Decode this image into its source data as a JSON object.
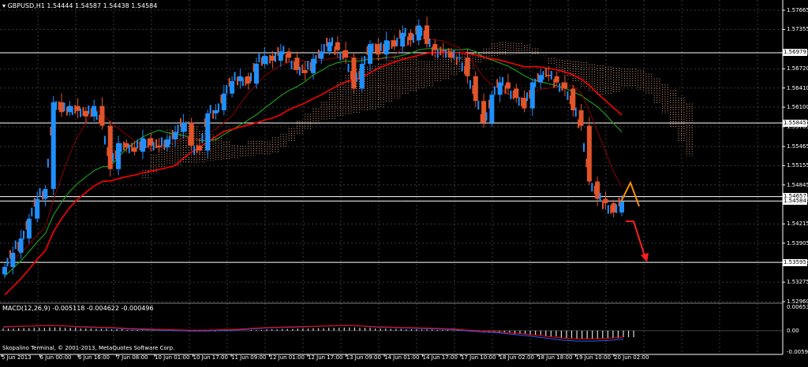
{
  "chart_header": {
    "symbol_title": "GBPUSD,H1",
    "ohlc": "1.54444 1.54587 1.54438 1.54584"
  },
  "macd_header": {
    "title": "MACD(12,26,9)",
    "values": "-0.005118 -0.004622 -0.000496"
  },
  "copyright": "Skopalino Terminal, © 2001-2013, MetaQuotes Software Corp.",
  "price_axis": [
    "1.57665",
    "1.57355",
    "1.56979",
    "1.56720",
    "1.56410",
    "1.56100",
    "1.55845",
    "1.55785",
    "1.55465",
    "1.55155",
    "1.54845",
    "1.54657",
    "1.54584",
    "1.54215",
    "1.53905",
    "1.53595",
    "1.53275",
    "1.52960"
  ],
  "macd_axis": [
    "0.006539",
    "0.00",
    "-0.005922"
  ],
  "level_boxes": [
    {
      "label": "1.56979"
    },
    {
      "label": "1.55845"
    },
    {
      "label": "1.54657"
    },
    {
      "label": "1.54584"
    },
    {
      "label": "1.53595"
    }
  ],
  "time_axis": [
    "5 Jun 2013",
    "6 Jun 00:00",
    "6 Jun 16:00",
    "7 Jun 08:00",
    "10 Jun 01:00",
    "10 Jun 17:00",
    "11 Jun 09:00",
    "12 Jun 01:00",
    "12 Jun 17:00",
    "13 Jun 09:00",
    "14 Jun 01:00",
    "14 Jun 17:00",
    "17 Jun 10:00",
    "18 Jun 02:00",
    "18 Jun 18:00",
    "19 Jun 10:00",
    "20 Jun 02:00"
  ],
  "colors": {
    "background": "#000000",
    "bull_candle": "#1e90ff",
    "bear_candle": "#e2542a",
    "ma_fast": "#ff0000",
    "ma_slow": "#1a9a1a",
    "cloud": "#e2a07a",
    "level_line": "#ffffff",
    "forecast_down": "#ff2020",
    "forecast_up": "#ff8c00",
    "macd_line": "#2060ff",
    "signal_line": "#ff0000",
    "histogram": "#dddddd"
  },
  "chart_data": [
    {
      "type": "candlestick",
      "title": "GBPUSD,H1",
      "ylim": [
        1.5296,
        1.5778
      ],
      "series": [
        {
          "name": "price",
          "values": [
            1.5352,
            1.5375,
            1.5398,
            1.543,
            1.5462,
            1.5478,
            1.5618,
            1.5602,
            1.5612,
            1.5604,
            1.5595,
            1.5612,
            1.558,
            1.551,
            1.5552,
            1.5545,
            1.5538,
            1.556,
            1.5548,
            1.5545,
            1.5558,
            1.557,
            1.5585,
            1.5548,
            1.554,
            1.56,
            1.5605,
            1.5632,
            1.5652,
            1.566,
            1.5648,
            1.568,
            1.5693,
            1.5685,
            1.57,
            1.569,
            1.567,
            1.5665,
            1.5688,
            1.57,
            1.5715,
            1.5702,
            1.569,
            1.564,
            1.568,
            1.5712,
            1.5695,
            1.5718,
            1.5708,
            1.573,
            1.5718,
            1.5742,
            1.5712,
            1.5702,
            1.57,
            1.569,
            1.569,
            1.566,
            1.562,
            1.5585,
            1.563,
            1.565,
            1.564,
            1.5625,
            1.5608,
            1.565,
            1.5662,
            1.566,
            1.565,
            1.564,
            1.5605,
            1.558,
            1.549,
            1.5462,
            1.5455,
            1.544,
            1.5458
          ]
        }
      ],
      "levels": [
        1.56979,
        1.55845,
        1.54657,
        1.54584,
        1.53595
      ]
    },
    {
      "type": "bar",
      "title": "MACD(12,26,9)",
      "ylim": [
        -0.005922,
        0.006539
      ],
      "series": [
        {
          "name": "histogram",
          "values": [
            0.0006,
            0.0007,
            0.0008,
            0.0009,
            0.0008,
            0.0006,
            0.0005,
            0.0004,
            0.0002,
            0.0001,
            0.0,
            -0.0001,
            -0.0002,
            -0.0002,
            -0.0001,
            0.0,
            0.0002,
            0.0004,
            0.0005,
            0.0006,
            0.0007,
            0.0008,
            0.0009,
            0.0008,
            0.0006,
            0.0005,
            0.0004,
            0.0003,
            0.0002,
            0.0001,
            -0.0002,
            -0.0004,
            -0.0006,
            -0.0009,
            -0.0012,
            -0.0016,
            -0.002,
            -0.0022,
            -0.0022,
            -0.0021,
            -0.0018
          ]
        }
      ]
    }
  ]
}
